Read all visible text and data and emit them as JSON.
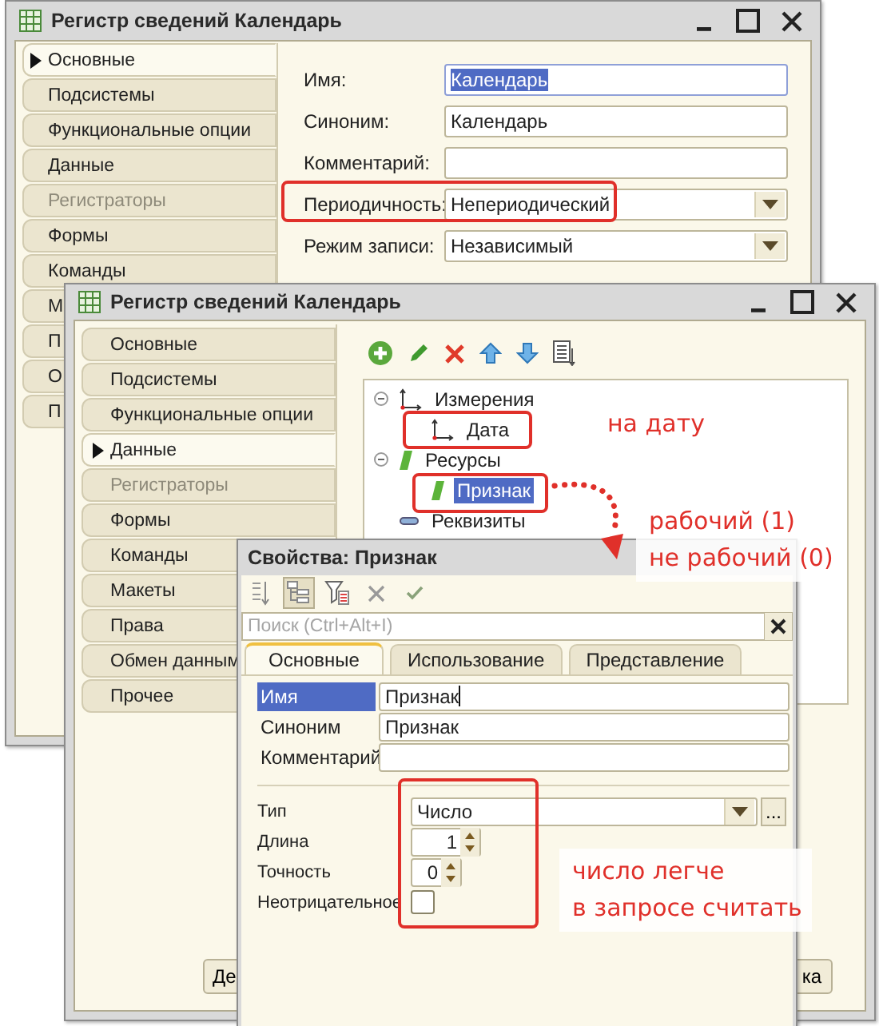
{
  "main_window": {
    "title": "Регистр сведений Календарь",
    "tabs": [
      {
        "label": "Основные",
        "selected": true,
        "disabled": false
      },
      {
        "label": "Подсистемы",
        "selected": false,
        "disabled": false
      },
      {
        "label": "Функциональные опции",
        "selected": false,
        "disabled": false
      },
      {
        "label": "Данные",
        "selected": false,
        "disabled": false
      },
      {
        "label": "Регистраторы",
        "selected": false,
        "disabled": true
      },
      {
        "label": "Формы",
        "selected": false,
        "disabled": false
      },
      {
        "label": "Команды",
        "selected": false,
        "disabled": false
      },
      {
        "label": "М",
        "selected": false,
        "disabled": false
      },
      {
        "label": "П",
        "selected": false,
        "disabled": false
      },
      {
        "label": "О",
        "selected": false,
        "disabled": false
      },
      {
        "label": "П",
        "selected": false,
        "disabled": false
      }
    ],
    "fields": [
      {
        "kind": "text",
        "label": "Имя:",
        "value": "Календарь",
        "highlighted": true
      },
      {
        "kind": "text",
        "label": "Синоним:",
        "value": "Календарь",
        "highlighted": false
      },
      {
        "kind": "text",
        "label": "Комментарий:",
        "highlighted": false
      },
      {
        "kind": "select",
        "label": "Периодичность:",
        "value": "Непериодический",
        "highlighted": false
      },
      {
        "kind": "select",
        "label": "Режим записи:",
        "value": "Независимый",
        "highlighted": false
      }
    ]
  },
  "data_window": {
    "title": "Регистр сведений Календарь",
    "tabs": [
      {
        "label": "Основные",
        "selected": false,
        "disabled": false
      },
      {
        "label": "Подсистемы",
        "selected": false,
        "disabled": false
      },
      {
        "label": "Функциональные опции",
        "selected": false,
        "disabled": false
      },
      {
        "label": "Данные",
        "selected": true,
        "disabled": false
      },
      {
        "label": "Регистраторы",
        "selected": false,
        "disabled": true
      },
      {
        "label": "Формы",
        "selected": false,
        "disabled": false
      },
      {
        "label": "Команды",
        "selected": false,
        "disabled": false
      },
      {
        "label": "Макеты",
        "selected": false,
        "disabled": false
      },
      {
        "label": "Права",
        "selected": false,
        "disabled": false
      },
      {
        "label": "Обмен данным",
        "selected": false,
        "disabled": false
      },
      {
        "label": "Прочее",
        "selected": false,
        "disabled": false
      }
    ],
    "toolbar": [
      {
        "kind": "add"
      },
      {
        "kind": "edit"
      },
      {
        "kind": "delete"
      },
      {
        "kind": "up"
      },
      {
        "kind": "down"
      },
      {
        "kind": "list"
      }
    ],
    "tree": [
      {
        "label": "Измерения",
        "expanded": true,
        "selected": false,
        "children": [
          {
            "label": "Дата",
            "selected": false
          }
        ]
      },
      {
        "label": "Ресурсы",
        "expanded": true,
        "selected": false,
        "children": [
          {
            "label": "Признак",
            "selected": true
          }
        ]
      },
      {
        "label": "Реквизиты",
        "selected": false
      }
    ],
    "buttons": [
      "Де",
      "ка"
    ]
  },
  "properties_window": {
    "title": "Свойства: Признак",
    "toolbar": [
      {
        "kind": "sort",
        "pressed": false
      },
      {
        "kind": "tree",
        "pressed": true
      },
      {
        "kind": "filter",
        "pressed": false
      },
      {
        "kind": "cancel",
        "pressed": false
      },
      {
        "kind": "ok",
        "pressed": false
      }
    ],
    "search": {
      "placeholder": "Поиск (Ctrl+Alt+I)"
    },
    "tabs": [
      {
        "label": "Основные",
        "selected": true
      },
      {
        "label": "Использование",
        "selected": false
      },
      {
        "label": "Представление",
        "selected": false
      }
    ],
    "fields": [
      {
        "label": "Имя",
        "value": "Признак",
        "selected": true
      },
      {
        "label": "Синоним",
        "value": "Признак",
        "selected": false
      },
      {
        "label": "Комментарий",
        "selected": false
      }
    ],
    "type_fields": [
      {
        "kind": "select",
        "label": "Тип",
        "value": "Число",
        "button": "..."
      },
      {
        "kind": "spin",
        "label": "Длина",
        "value": "1"
      },
      {
        "kind": "spin",
        "label": "Точность",
        "value": "0"
      },
      {
        "kind": "checkbox",
        "label": "Неотрицательное",
        "checked": false
      }
    ]
  },
  "annotations": [
    {
      "lines": [
        "на дату"
      ]
    },
    {
      "lines": [
        "рабочий (1)",
        "не рабочий (0)"
      ]
    },
    {
      "lines": [
        "число легче",
        "в запросе считать"
      ]
    }
  ]
}
